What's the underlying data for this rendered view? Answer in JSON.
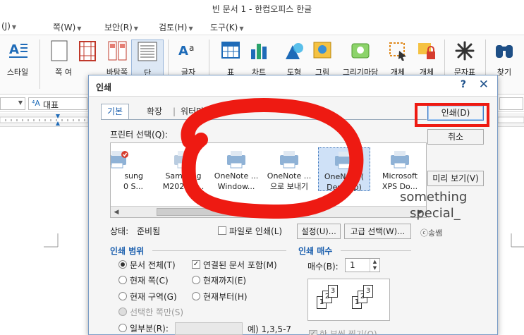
{
  "window": {
    "title": "빈 문서 1 - 한컴오피스 한글"
  },
  "menubar": {
    "items": [
      "(J)",
      "쪽(W)",
      "보안(R)",
      "검토(H)",
      "도구(K)"
    ]
  },
  "ribbon": {
    "buttons": [
      "스타일",
      "쪽 여",
      "바탕쪽",
      "단",
      "글자",
      "표",
      "차트",
      "도형",
      "그림",
      "그리기마당",
      "개체",
      "개체",
      "문자표",
      "찾기"
    ]
  },
  "formatbar": {
    "style_value": "대표"
  },
  "dialog": {
    "title": "인쇄",
    "help": "?",
    "close": "✕",
    "tabs": [
      "기본",
      "확장",
      "워터마크"
    ],
    "tab_separator": "|",
    "printer_select_label": "프린터 선택(Q):",
    "printers": [
      {
        "line1": "sung",
        "line2": "0 S..."
      },
      {
        "line1": "Samsung",
        "line2": "M2020 S..."
      },
      {
        "line1": "OneNote ...",
        "line2": "Window..."
      },
      {
        "line1": "OneNote ...",
        "line2": "으로 보내기"
      },
      {
        "line1": "OneNote (",
        "line2": "Desktop)"
      },
      {
        "line1": "Microsoft",
        "line2": "XPS Do..."
      }
    ],
    "selected_printer_index": 4,
    "status_label": "상태:",
    "status_value": "준비됨",
    "print_to_file": "파일로 인쇄(L)",
    "settings_button": "설정(U)...",
    "advanced_button": "고급 선택(W)...",
    "print_button": "인쇄(D)",
    "cancel_button": "취소",
    "preview_button": "미리 보기(V)",
    "range_title": "인쇄 범위",
    "range_options": {
      "whole": "문서 전체(T)",
      "linked": "연결된 문서 포함(M)",
      "current_page": "현재 쪽(C)",
      "until_current": "현재까지(E)",
      "current_section": "현재 구역(G)",
      "from_current": "현재부터(H)",
      "selected_only": "선택한 쪽만(S)",
      "partial": "일부분(R):",
      "partial_example": "예) 1,3,5-7"
    },
    "copies_title": "인쇄 매수",
    "copies_label": "매수(B):",
    "copies_value": "1",
    "collate_label": "한 부씩 찍기(O)",
    "collate_pages": [
      "1",
      "2",
      "3",
      "1",
      "2",
      "3"
    ]
  },
  "watermark": {
    "line1": "something",
    "line2": "special_",
    "credit": "ⓒ송쌤"
  },
  "colors": {
    "accent": "#1b5fae",
    "annotation_red": "#ee1a12"
  }
}
